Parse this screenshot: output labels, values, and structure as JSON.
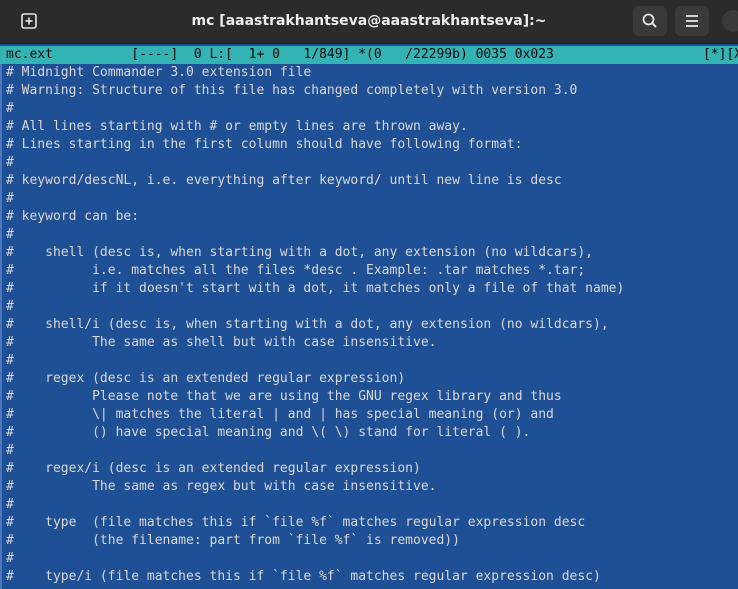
{
  "window": {
    "title": "mc [aaastrakhantseva@aaastrakhantseva]:~"
  },
  "toolbar": {
    "new_tab_icon": "plus-square-icon",
    "search_icon": "search-icon",
    "menu_icon": "hamburger-menu-icon"
  },
  "editor": {
    "status_left": "mc.ext          [----]  0 L:[  1+ 0   1/849] *(0   /22299b) 0035 0x023",
    "status_right": "[*][X]",
    "lines": [
      "# Midnight Commander 3.0 extension file",
      "# Warning: Structure of this file has changed completely with version 3.0",
      "#",
      "# All lines starting with # or empty lines are thrown away.",
      "# Lines starting in the first column should have following format:",
      "#",
      "# keyword/descNL, i.e. everything after keyword/ until new line is desc",
      "#",
      "# keyword can be:",
      "#",
      "#    shell (desc is, when starting with a dot, any extension (no wildcars),",
      "#          i.e. matches all the files *desc . Example: .tar matches *.tar;",
      "#          if it doesn't start with a dot, it matches only a file of that name)",
      "#",
      "#    shell/i (desc is, when starting with a dot, any extension (no wildcars),",
      "#          The same as shell but with case insensitive.",
      "#",
      "#    regex (desc is an extended regular expression)",
      "#          Please note that we are using the GNU regex library and thus",
      "#          \\| matches the literal | and | has special meaning (or) and",
      "#          () have special meaning and \\( \\) stand for literal ( ).",
      "#",
      "#    regex/i (desc is an extended regular expression)",
      "#          The same as regex but with case insensitive.",
      "#",
      "#    type  (file matches this if `file %f` matches regular expression desc",
      "#          (the filename: part from `file %f` is removed))",
      "#",
      "#    type/i (file matches this if `file %f` matches regular expression desc)"
    ]
  },
  "colors": {
    "terminal_bg": "#1f4f94",
    "status_bg": "#33b3b3",
    "text": "#d8d8d8",
    "titlebar_bg": "#2b2b2b"
  }
}
